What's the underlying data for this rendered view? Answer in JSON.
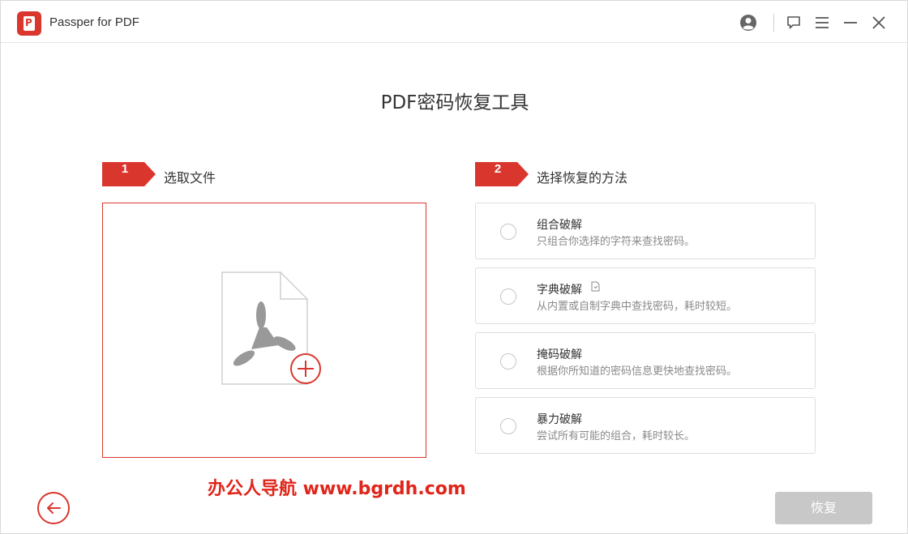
{
  "app": {
    "title": "Passper for PDF"
  },
  "page": {
    "title": "PDF密码恢复工具"
  },
  "steps": [
    {
      "number": "1",
      "label": "选取文件"
    },
    {
      "number": "2",
      "label": "选择恢复的方法"
    }
  ],
  "options": [
    {
      "title": "组合破解",
      "description": "只组合你选择的字符来查找密码。"
    },
    {
      "title": "字典破解",
      "description": "从内置或自制字典中查找密码，耗时较短。"
    },
    {
      "title": "掩码破解",
      "description": "根据你所知道的密码信息更快地查找密码。"
    },
    {
      "title": "暴力破解",
      "description": "尝试所有可能的组合，耗时较长。"
    }
  ],
  "watermark": "办公人导航 www.bgrdh.com",
  "buttons": {
    "recover": "恢复"
  },
  "colors": {
    "accent": "#d9372e",
    "disabled": "#c8c8c8",
    "watermark": "#e0251b"
  }
}
